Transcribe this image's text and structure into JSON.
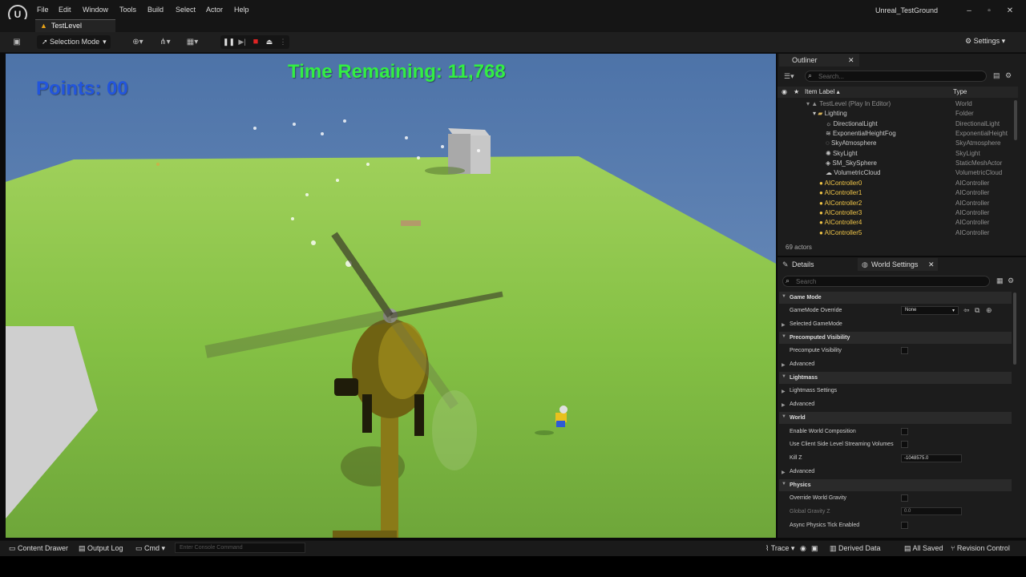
{
  "menu": [
    "File",
    "Edit",
    "Window",
    "Tools",
    "Build",
    "Select",
    "Actor",
    "Help"
  ],
  "project_name": "Unreal_TestGround",
  "level_tab": "TestLevel",
  "toolbar": {
    "selection_mode": "Selection Mode",
    "settings": "Settings"
  },
  "hud": {
    "points_label": "Points:",
    "points_value": "00",
    "timer": "Time Remaining: 11,768"
  },
  "outliner": {
    "tab": "Outliner",
    "search_placeholder": "Search...",
    "col_label": "Item Label ▴",
    "col_type": "Type",
    "rows": [
      {
        "label": "TestLevel (Play In Editor)",
        "type": "World"
      },
      {
        "label": "Lighting",
        "type": "Folder"
      },
      {
        "label": "DirectionalLight",
        "type": "DirectionalLight"
      },
      {
        "label": "ExponentialHeightFog",
        "type": "ExponentialHeight"
      },
      {
        "label": "SkyAtmosphere",
        "type": "SkyAtmosphere"
      },
      {
        "label": "SkyLight",
        "type": "SkyLight"
      },
      {
        "label": "SM_SkySphere",
        "type": "StaticMeshActor"
      },
      {
        "label": "VolumetricCloud",
        "type": "VolumetricCloud"
      },
      {
        "label": "AIController0",
        "type": "AIController"
      },
      {
        "label": "AIController1",
        "type": "AIController"
      },
      {
        "label": "AIController2",
        "type": "AIController"
      },
      {
        "label": "AIController3",
        "type": "AIController"
      },
      {
        "label": "AIController4",
        "type": "AIController"
      },
      {
        "label": "AIController5",
        "type": "AIController"
      }
    ],
    "actor_count": "69 actors"
  },
  "details": {
    "tab_details": "Details",
    "tab_world_settings": "World Settings",
    "search_placeholder": "Search",
    "sections": {
      "game_mode": "Game Mode",
      "precomputed_visibility": "Precomputed Visibility",
      "lightmass": "Lightmass",
      "world": "World",
      "physics": "Physics"
    },
    "props": {
      "gamemode_override": "GameMode Override",
      "gamemode_value": "None",
      "selected_gamemode": "Selected GameMode",
      "precompute_visibility": "Precompute Visibility",
      "advanced": "Advanced",
      "lightmass_settings": "Lightmass Settings",
      "enable_world_composition": "Enable World Composition",
      "client_side_streaming": "Use Client Side Level Streaming Volumes",
      "kill_z": "Kill Z",
      "kill_z_value": "-1048575.0",
      "override_world_gravity": "Override World Gravity",
      "global_gravity_z": "Global Gravity Z",
      "global_gravity_value": "0.0",
      "async_physics": "Async Physics Tick Enabled"
    }
  },
  "statusbar": {
    "content_drawer": "Content Drawer",
    "output_log": "Output Log",
    "cmd": "Cmd",
    "console_placeholder": "Enter Console Command",
    "trace": "Trace",
    "derived_data": "Derived Data",
    "all_saved": "All Saved",
    "revision_control": "Revision Control"
  },
  "colors": {
    "points": "#2255dd",
    "timer": "#33ee44",
    "ai_controller": "#f0c548"
  }
}
